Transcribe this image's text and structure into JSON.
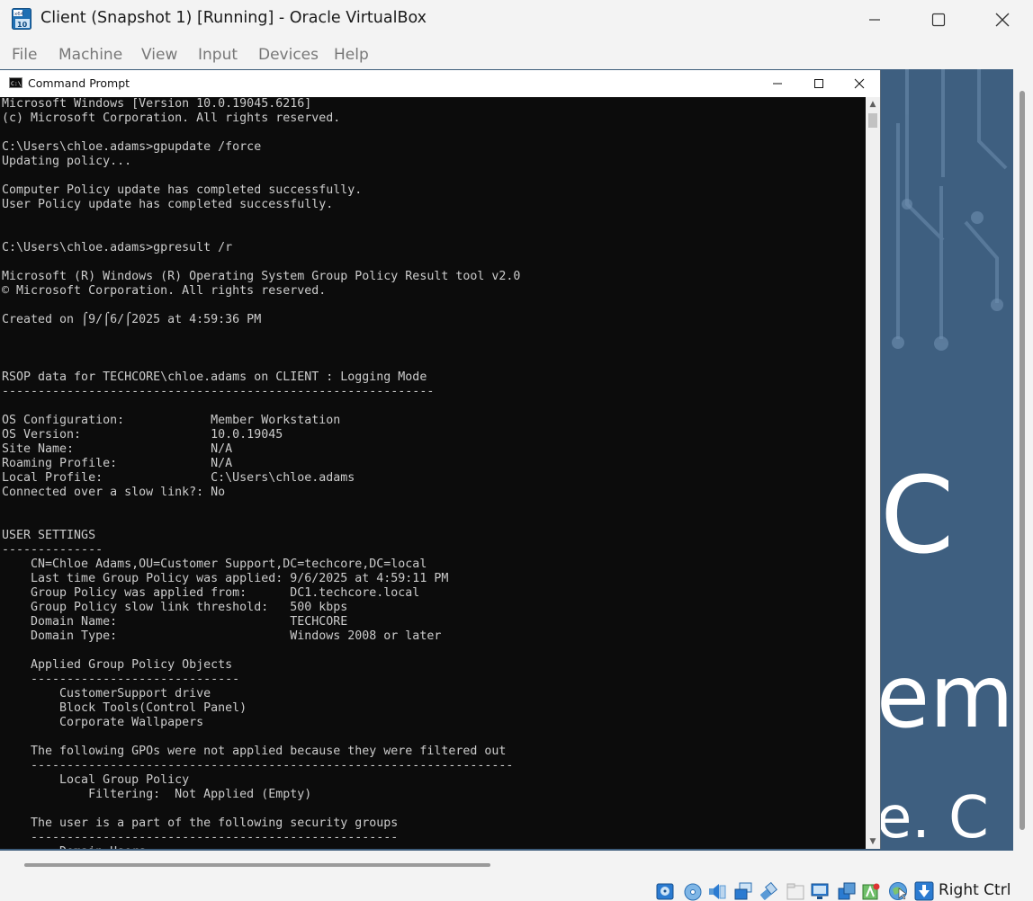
{
  "window": {
    "title": "Client (Snapshot 1) [Running] - Oracle VirtualBox",
    "app_icon": "virtualbox-icon",
    "app_icon_text": "x64 10"
  },
  "menubar": [
    "File",
    "Machine",
    "View",
    "Input",
    "Devices",
    "Help"
  ],
  "cmd": {
    "title": "Command Prompt",
    "lines": [
      "Microsoft Windows [Version 10.0.19045.6216]",
      "(c) Microsoft Corporation. All rights reserved.",
      "",
      "C:\\Users\\chloe.adams>gpupdate /force",
      "Updating policy...",
      "",
      "Computer Policy update has completed successfully.",
      "User Policy update has completed successfully.",
      "",
      "",
      "C:\\Users\\chloe.adams>gpresult /r",
      "",
      "Microsoft (R) Windows (R) Operating System Group Policy Result tool v2.0",
      "© Microsoft Corporation. All rights reserved.",
      "",
      "Created on ⌠9/⌠6/⌠2025 at 4:59:36 PM",
      "",
      "",
      "",
      "RSOP data for TECHCORE\\chloe.adams on CLIENT : Logging Mode",
      "------------------------------------------------------------",
      "",
      "OS Configuration:            Member Workstation",
      "OS Version:                  10.0.19045",
      "Site Name:                   N/A",
      "Roaming Profile:             N/A",
      "Local Profile:               C:\\Users\\chloe.adams",
      "Connected over a slow link?: No",
      "",
      "",
      "USER SETTINGS",
      "--------------",
      "    CN=Chloe Adams,OU=Customer Support,DC=techcore,DC=local",
      "    Last time Group Policy was applied: 9/6/2025 at 4:59:11 PM",
      "    Group Policy was applied from:      DC1.techcore.local",
      "    Group Policy slow link threshold:   500 kbps",
      "    Domain Name:                        TECHCORE",
      "    Domain Type:                        Windows 2008 or later",
      "",
      "    Applied Group Policy Objects",
      "    -----------------------------",
      "        CustomerSupport drive",
      "        Block Tools(Control Panel)",
      "        Corporate Wallpapers",
      "",
      "    The following GPOs were not applied because they were filtered out",
      "    -------------------------------------------------------------------",
      "        Local Group Policy",
      "            Filtering:  Not Applied (Empty)",
      "",
      "    The user is a part of the following security groups",
      "    ---------------------------------------------------",
      "        Domain Users"
    ]
  },
  "desktop": {
    "wallpaper_text": [
      "C",
      "em",
      "e. C"
    ]
  },
  "statusbar": {
    "icons": [
      "hard-disk-icon",
      "optical-drive-icon",
      "audio-icon",
      "network-icon",
      "usb-icon",
      "shared-folders-icon",
      "display-icon",
      "video-capture-icon",
      "recording-icon",
      "mouse-integration-icon",
      "keyboard-capture-icon"
    ],
    "host_key": "Right Ctrl"
  },
  "colors": {
    "console_bg": "#0c0c0c",
    "console_fg": "#cccccc",
    "wallpaper": "#3e5f80",
    "chrome": "#f3f3f3"
  }
}
